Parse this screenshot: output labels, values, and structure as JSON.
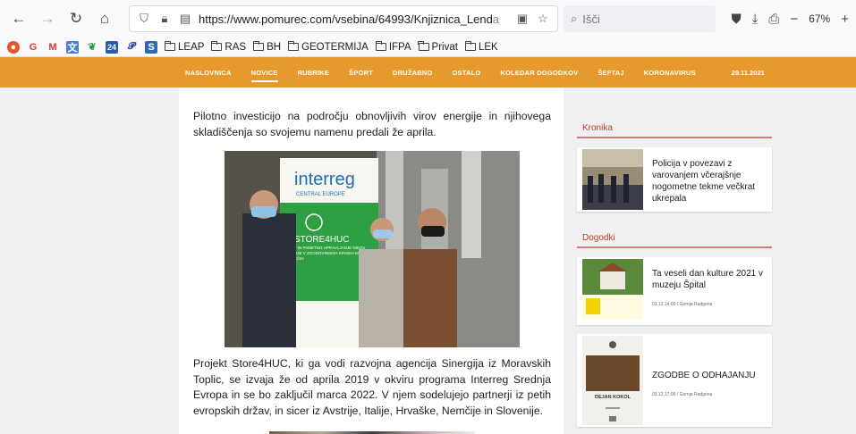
{
  "browser": {
    "url_main": "https://www.pomurec.com/vsebina/64993/Knjiznica_Lend",
    "url_faded": "a",
    "search_placeholder": "Išči",
    "zoom": "67%"
  },
  "bookmarks": [
    {
      "label": "LEAP"
    },
    {
      "label": "RAS"
    },
    {
      "label": "BH"
    },
    {
      "label": "GEOTERMIJA"
    },
    {
      "label": "IFPA"
    },
    {
      "label": "Privat"
    },
    {
      "label": "LEK"
    }
  ],
  "sitenav": {
    "items": [
      "NASLOVNICA",
      "NOVICE",
      "RUBRIKE",
      "ŠPORT",
      "DRUŽABNO",
      "OSTALO",
      "KOLEDAR DOGODKOV",
      "ŠEFTAJ",
      "KORONAVIRUS"
    ],
    "active_index": 1,
    "date": "29.11.2021"
  },
  "article": {
    "intro": "Pilotno investicijo na področju obnovljivih virov energije in njihovega skladiščenja so svojemu namenu predali že aprila.",
    "banner_brand": "interreg",
    "banner_sub": "CENTRAL EUROPE",
    "banner_project": "STORE4HUC",
    "banner_text": "UČITEV IN PAMETNO UPRAVLJANJE NIKOV ENERGIJE V ZGODOVINSKIH KRANIH MESTNIH SREDIŠČIH",
    "body": "Projekt Store4HUC, ki ga vodi razvojna agencija Sinergija iz Moravskih Toplic, se izvaja že od aprila 2019 v okviru programa Interreg Srednja Evropa in se bo zaključil marca 2022. V njem sodelujejo partnerji iz petih evropskih držav, in sicer iz Avstrije, Italije, Hrvaške, Nemčije in Slovenije."
  },
  "sidebar": {
    "kronika_title": "Kronika",
    "kronika_item": "Policija v povezavi z varovanjem včerajšnje nogometne tekme večkrat ukrepala",
    "dogodki_title": "Dogodki",
    "event1_title": "Ta veseli dan kulture 2021 v muzeju Špital",
    "event1_meta": "03.12.14:00 / Gornja Radgona",
    "event2_title": "ZGODBE O ODHAJANJU",
    "event2_meta": "03.12.17:00 / Gornja Radgona",
    "event2_author": "DEJAN KOKOL"
  }
}
